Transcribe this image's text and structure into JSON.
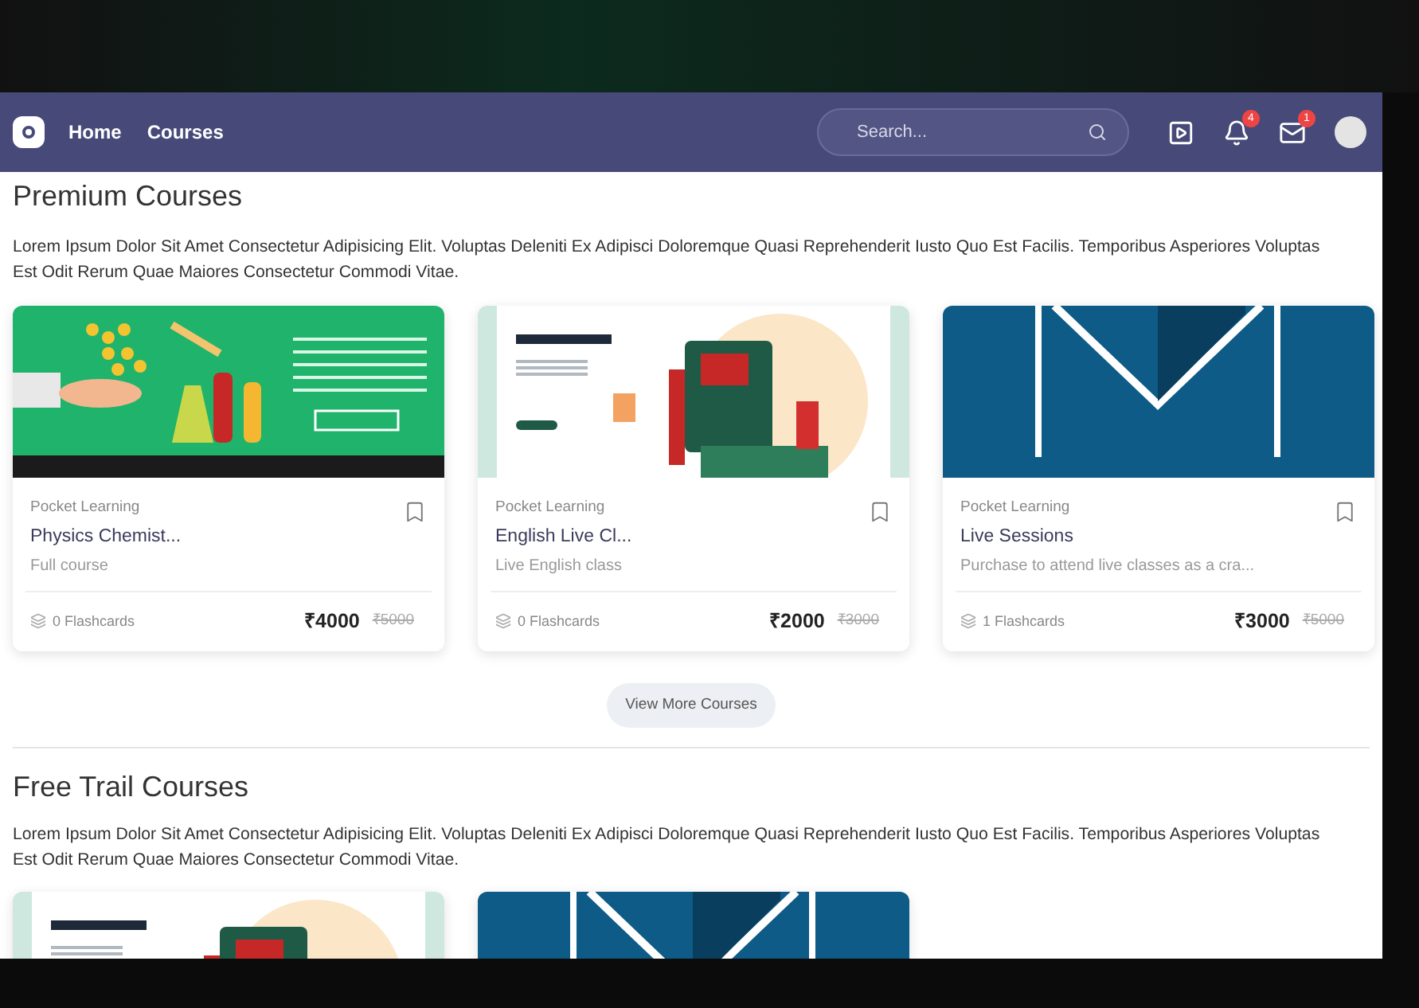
{
  "navbar": {
    "links": [
      {
        "label": "Home"
      },
      {
        "label": "Courses"
      }
    ],
    "search": {
      "placeholder": "Search..."
    },
    "icons": [
      {
        "kind": "video"
      },
      {
        "kind": "bell",
        "badge": "4"
      },
      {
        "kind": "mail",
        "badge": "1"
      },
      {
        "kind": "avatar"
      }
    ]
  },
  "premium": {
    "title": "Premium Courses",
    "description": "Lorem Ipsum Dolor Sit Amet Consectetur Adipisicing Elit. Voluptas Deleniti Ex Adipisci Doloremque Quasi Reprehenderit Iusto Quo Est Facilis. Temporibus Asperiores Voluptas Est Odit Rerum Quae Maiores Consectetur Commodi Vitae.",
    "courses": [
      {
        "kind": "science",
        "provider": "Pocket Learning",
        "title": "Physics Chemist...",
        "subtitle": "Full course",
        "flashcards": "0 Flashcards",
        "price": "₹4000",
        "old_price": "₹5000"
      },
      {
        "kind": "english",
        "provider": "Pocket Learning",
        "title": "English Live Cl...",
        "subtitle": "Live English class",
        "flashcards": "0 Flashcards",
        "price": "₹2000",
        "old_price": "₹3000"
      },
      {
        "kind": "myclass",
        "provider": "Pocket Learning",
        "title": "Live Sessions",
        "subtitle": "Purchase to attend live classes as a cra...",
        "flashcards": "1 Flashcards",
        "price": "₹3000",
        "old_price": "₹5000"
      }
    ],
    "button": "View More Courses"
  },
  "free": {
    "title": "Free Trail Courses",
    "description": "Lorem Ipsum Dolor Sit Amet Consectetur Adipisicing Elit. Voluptas Deleniti Ex Adipisci Doloremque Quasi Reprehenderit Iusto Quo Est Facilis. Temporibus Asperiores Voluptas Est Odit Rerum Quae Maiores Consectetur Commodi Vitae.",
    "courses": [
      {
        "kind": "english"
      },
      {
        "kind": "myclass"
      }
    ]
  }
}
